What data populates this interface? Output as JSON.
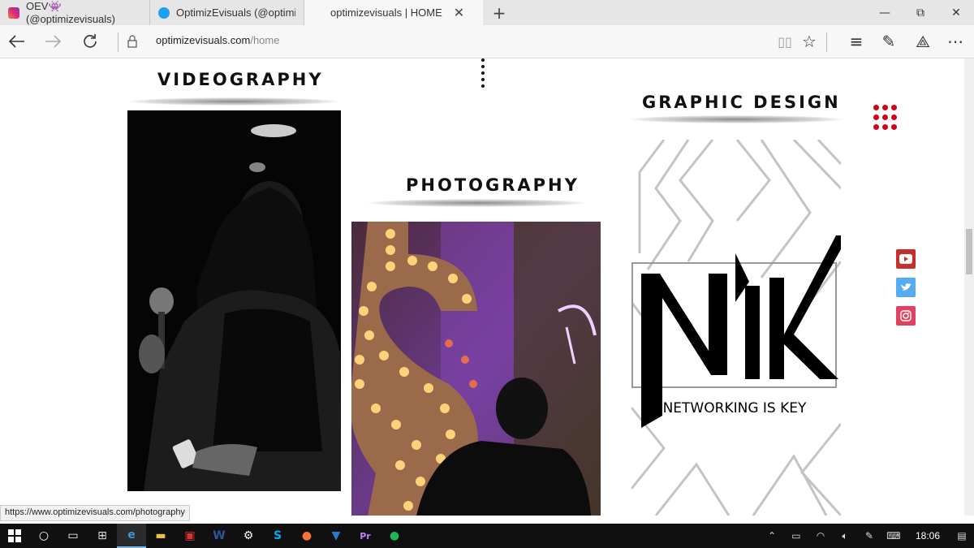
{
  "browser": {
    "tabs": [
      {
        "label": "OEV👾 (@optimizevisuals)",
        "icon": "instagram-icon",
        "active": false
      },
      {
        "label": "OptimizEvisuals (@optimize",
        "icon": "twitter-icon",
        "active": false
      },
      {
        "label": "optimizevisuals | HOME",
        "icon": "",
        "active": true
      }
    ],
    "new_tab": "+",
    "window_controls": {
      "minimize": "—",
      "restore": "⧉",
      "close": "✕"
    },
    "address": {
      "host": "optimizevisuals.com",
      "path": "/home"
    }
  },
  "page": {
    "sections": {
      "videography": "VIDEOGRAPHY",
      "photography": "PHOTOGRAPHY",
      "graphic_design": "GRAPHIC DESIGN"
    },
    "logo": {
      "letters": "NIK",
      "tagline": "NETWORKING IS KEY"
    },
    "social": [
      "youtube-icon",
      "twitter-icon",
      "instagram-icon"
    ],
    "accent_color": "#d0021b"
  },
  "status_url": "https://www.optimizevisuals.com/photography",
  "taskbar": {
    "time": "18:06"
  }
}
